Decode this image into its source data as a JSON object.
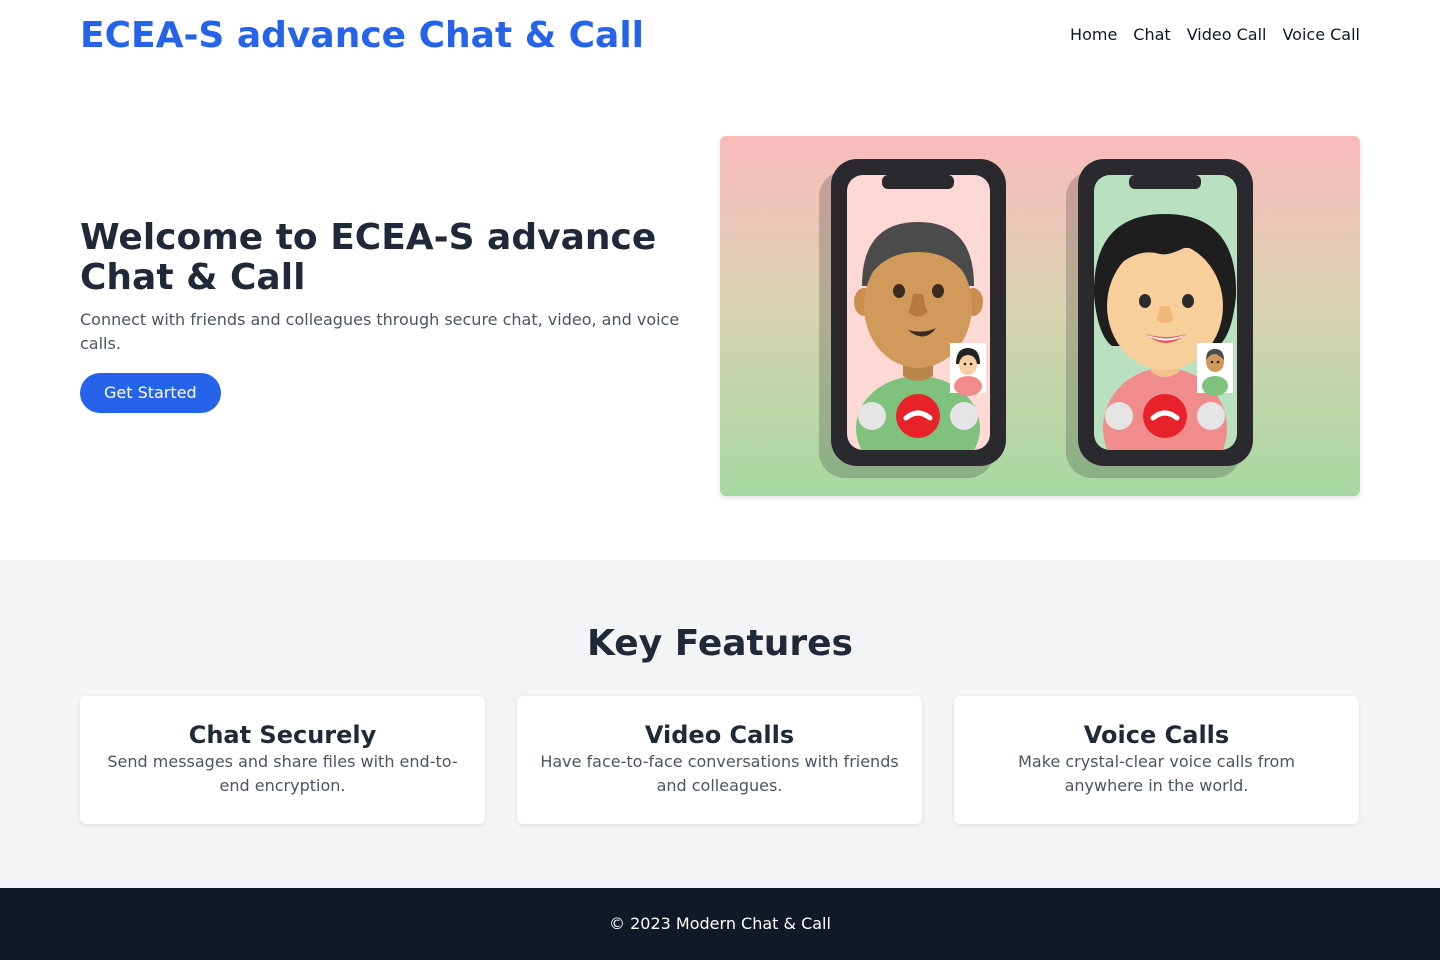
{
  "header": {
    "brand": "ECEA-S advance Chat & Call",
    "nav": [
      "Home",
      "Chat",
      "Video Call",
      "Voice Call"
    ]
  },
  "hero": {
    "title": "Welcome to ECEA-S advance Chat & Call",
    "subtitle": "Connect with friends and colleagues through secure chat, video, and voice calls.",
    "cta": "Get Started",
    "illustration": "video-call-illustration"
  },
  "features": {
    "title": "Key Features",
    "cards": [
      {
        "title": "Chat Securely",
        "text": "Send messages and share files with end-to-end encryption."
      },
      {
        "title": "Video Calls",
        "text": "Have face-to-face conversations with friends and colleagues."
      },
      {
        "title": "Voice Calls",
        "text": "Make crystal-clear voice calls from anywhere in the world."
      }
    ]
  },
  "footer": {
    "text": "© 2023 Modern Chat & Call"
  },
  "colors": {
    "accent": "#2563eb",
    "footer_bg": "#111827",
    "section_bg": "#f3f4f6"
  }
}
